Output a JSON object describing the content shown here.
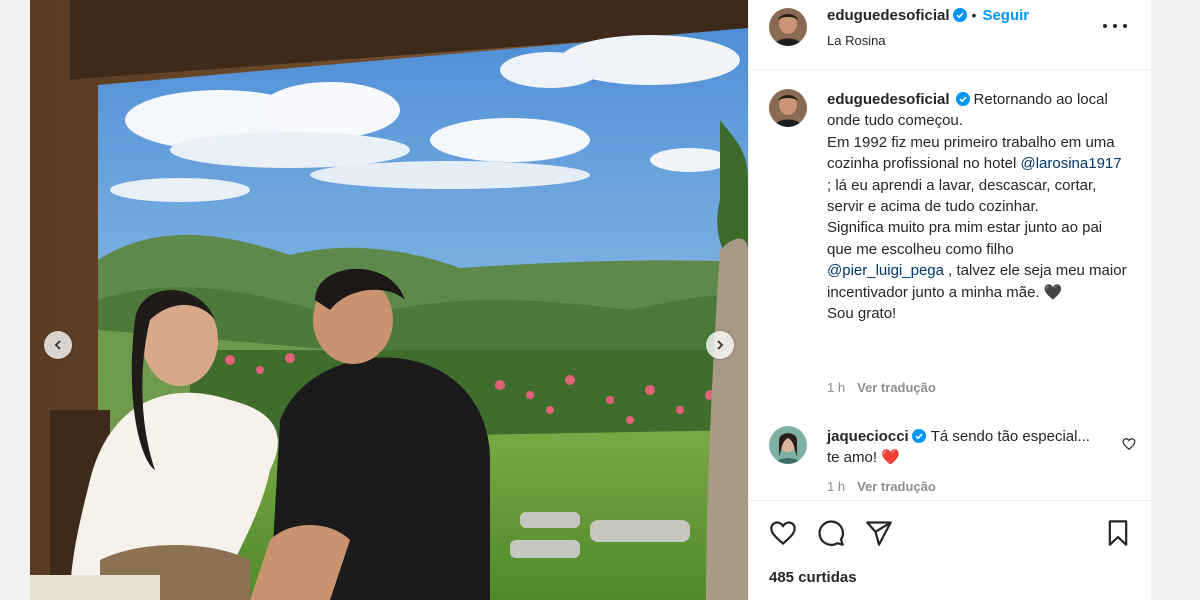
{
  "post": {
    "username": "eduguedesoficial",
    "follow_label": "Seguir",
    "separator": "•",
    "location": "La Rosina",
    "more_icon": "more-horizontal-icon"
  },
  "caption": {
    "username": "eduguedesoficial",
    "line1": "Retornando ao local onde tudo começou.",
    "line2_before": "Em 1992 fiz meu primeiro trabalho em uma cozinha profissional no hotel ",
    "mention1": "@larosina1917",
    "line2_after": " ; lá eu aprendi a lavar, descascar, cortar, servir e acima de tudo cozinhar.",
    "line3_before": "Significa muito pra mim estar junto ao pai que me escolheu como filho ",
    "mention2": "@pier_luigi_pega",
    "line3_after": " , talvez ele seja meu maior incentivador junto a minha mãe. 🖤",
    "line4": "Sou grato!",
    "time": "1 h",
    "see_translation": "Ver tradução"
  },
  "comment": {
    "username": "jaqueciocci",
    "text": "Tá sendo tão especial... te amo! ❤️",
    "time": "1 h",
    "see_translation": "Ver tradução"
  },
  "actions": {
    "icons": [
      "heart-icon",
      "comment-icon",
      "share-icon",
      "save-icon"
    ],
    "likes": "485 curtidas"
  },
  "colors": {
    "link_blue": "#0095f6",
    "mention": "#00376b",
    "verified": "#0095f6",
    "muted": "#8e8e8e"
  }
}
